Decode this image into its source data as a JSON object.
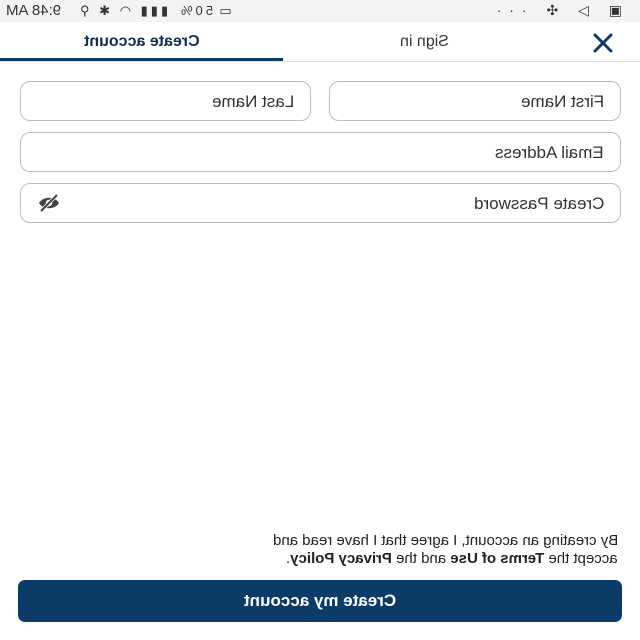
{
  "status_bar": {
    "time": "9:48 AM",
    "battery_percent": "50%",
    "icons_left": [
      "bluetooth-icon",
      "location-icon",
      "wifi-icon",
      "signal-icon",
      "battery-icon"
    ],
    "icons_right": [
      "more-dots-icon",
      "fan-icon",
      "send-icon",
      "gallery-icon"
    ]
  },
  "tabs": [
    {
      "label": "Create account",
      "selected": true
    },
    {
      "label": "Sign in",
      "selected": false
    }
  ],
  "form": {
    "first_name": {
      "placeholder": "First Name",
      "value": ""
    },
    "last_name": {
      "placeholder": "Last Name",
      "value": ""
    },
    "email": {
      "placeholder": "Email Address",
      "value": ""
    },
    "password": {
      "placeholder": "Create Password",
      "value": ""
    }
  },
  "terms": {
    "line1": "By creating an account, I agree that I have read and",
    "accept": "accept the",
    "terms_of_use": "Terms of Use",
    "and_the": "and the",
    "privacy_policy": "Privacy Policy",
    "period": "."
  },
  "submit_label": "Create my account",
  "colors": {
    "primary": "#0d3b68",
    "border": "#bdbdbd"
  }
}
